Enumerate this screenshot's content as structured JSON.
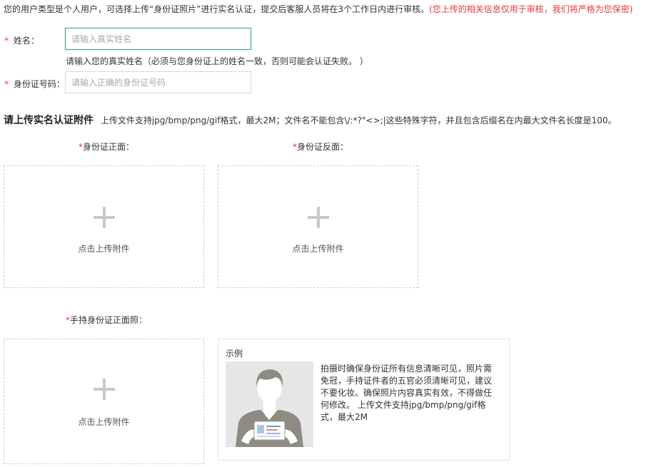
{
  "notice": {
    "text": "您的用户类型是个人用户，可选择上传“身份证照片”进行实名认证，提交后客服人员将在3个工作日内进行审核。",
    "warning": "(您上传的相关信息仅用于审核，我们将严格为您保密)"
  },
  "required_mark": "*",
  "name_field": {
    "label": "姓名：",
    "placeholder": "请输入真实姓名",
    "value": "",
    "hint": "请输入您的真实姓名（必须与您身份证上的姓名一致，否则可能会认证失败。 ）"
  },
  "id_field": {
    "label": "身份证号码：",
    "placeholder": "请输入正确的身份证号码",
    "value": ""
  },
  "attachments": {
    "title": "请上传实名认证附件",
    "note": "上传文件支持jpg/bmp/png/gif格式，最大2M；文件名不能包含\\/:*?\"<>;|这些特殊字符，并且包含后缀名在内最大文件名长度是100。"
  },
  "uploads": {
    "front": {
      "label": "身份证正面：",
      "text": "点击上传附件"
    },
    "back": {
      "label": "身份证反面：",
      "text": "点击上传附件"
    },
    "handheld": {
      "label": "手持身份证正面照：",
      "text": "点击上传附件"
    }
  },
  "example": {
    "title": "示例",
    "description": "拍摄时确保身份证所有信息清晰可见，照片需免冠，手持证件者的五官必须清晰可见，建议不要化妆。确保照片内容真实有效，不得做任何修改。 上传文件支持jpg/bmp/png/gif格式，最大2M"
  },
  "colors": {
    "required": "#e4393c",
    "focus_border": "#3aa39a",
    "dashed_border": "#cfcfcf",
    "plus": "#c8c8c8",
    "example_bg": "#e6e6e6",
    "figure": "#8e8b82"
  }
}
